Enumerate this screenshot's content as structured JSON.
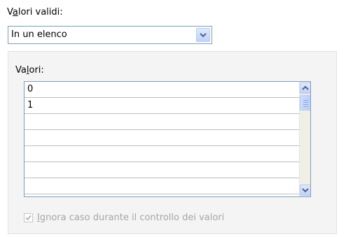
{
  "valid_values": {
    "label_pre": "V",
    "label_accel": "a",
    "label_post": "lori validi:",
    "selected": "In un elenco"
  },
  "values_list": {
    "label_pre": "Va",
    "label_accel": "l",
    "label_post": "ori:",
    "rows": [
      "0",
      "1",
      "",
      "",
      "",
      "",
      ""
    ]
  },
  "ignore_case": {
    "accel": "I",
    "label_rest": "gnora caso durante il controllo dei valori",
    "checked": true,
    "enabled": false
  },
  "icons": {
    "combo": "chevron-down-icon",
    "scroll_up": "chevron-up-icon",
    "scroll_down": "chevron-down-icon",
    "checkbox": "check-icon"
  }
}
